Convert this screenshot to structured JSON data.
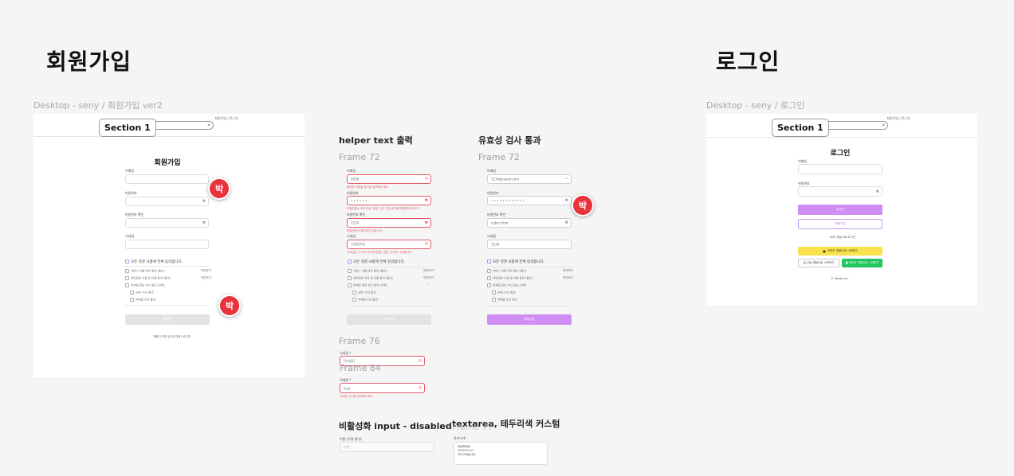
{
  "headings": {
    "signup": "회원가입",
    "login": "로그인"
  },
  "frames": {
    "signup_desktop": "Desktop - seny / 회원가입 ver2",
    "login_desktop": "Desktop - seny / 로그인",
    "helper_title": "helper text 출력",
    "helper_frame": "Frame 72",
    "valid_title": "유효성 검사 통과",
    "valid_frame": "Frame 72",
    "frame76": "Frame 76",
    "frame84": "Frame 84",
    "disabled_title": "비활성화 input - disabled",
    "textarea_title": "textarea, 테두리색 커스텀",
    "textarea_frame": "Frame 77"
  },
  "section_badge": "Section 1",
  "top_links": "회원가입 | 로그인",
  "avatar_letter": "박",
  "signup_form": {
    "title": "회원가입",
    "labels": [
      "이메일",
      "비밀번호",
      "비밀번호 확인",
      "닉네임"
    ],
    "agree_all": "모든 약관 사항에 전체 동의합니다.",
    "terms": [
      {
        "text": "서비스 이용 약관 동의 (필수)",
        "view": "약관보기"
      },
      {
        "text": "개인정보 수집 및 이용 동의 (필수)",
        "view": "약관보기"
      },
      {
        "text": "마케팅 정보 수신 동의 (선택)",
        "view": "⌄"
      }
    ],
    "sub_terms": [
      "SMS 수신 동의",
      "이메일 수신 동의"
    ],
    "submit": "회원가입",
    "footer": "계정이 이미 있으신가요? 로그인"
  },
  "helper_form": {
    "labels": [
      "이메일",
      "비밀번호",
      "비밀번호 확인",
      "닉네임"
    ],
    "values": [
      "2034",
      "• • • • • •",
      "1234",
      "닉네임가능"
    ],
    "errors": [
      "올바른 이메일 형식을 입력해주세요.",
      "비밀번호는 8자 이상, 영문, 숫자, 특수문자를 포함해야 합니다.",
      "비밀번호가 일치하지 않습니다.",
      "닉네임은 2-10자 이내의 한글, 영문, 숫자만 가능합니다."
    ],
    "agree_all": "모든 약관 사항에 전체 동의합니다.",
    "terms": [
      {
        "text": "서비스 이용 약관 동의 (필수)",
        "view": "약관보기"
      },
      {
        "text": "개인정보 수집 및 이용 동의 (필수)",
        "view": "약관보기"
      },
      {
        "text": "마케팅 정보 수신 동의 (선택)",
        "view": "⌄"
      }
    ],
    "sub_terms": [
      "SMS 수신 동의",
      "이메일 수신 동의"
    ],
    "submit": "회원가입"
  },
  "valid_form": {
    "labels": [
      "이메일",
      "비밀번호",
      "비밀번호 확인",
      "닉네임"
    ],
    "values": [
      "1234@naver.com",
      "• • • • • • • • • • • •",
      "cyber hum",
      "1234"
    ],
    "agree_all": "모든 약관 사항에 전체 동의합니다.",
    "terms": [
      {
        "text": "서비스 이용 약관 동의 (필수)",
        "view": "약관보기"
      },
      {
        "text": "개인정보 수집 및 이용 동의 (필수)",
        "view": "약관보기"
      },
      {
        "text": "마케팅 정보 수신 동의 (선택)",
        "view": "⌄"
      }
    ],
    "sub_terms": [
      "SMS 수신 동의",
      "이메일 수신 동의"
    ],
    "submit": "회원가입"
  },
  "frame76": {
    "label": "닉네임 *",
    "value": "[닉네임]",
    "error": ""
  },
  "frame84": {
    "label": "이메일 *",
    "value": "d:sk",
    "error": "이메일 주소를 입력해주세요."
  },
  "disabled_input": {
    "label": "이름 (수정 불가)",
    "value": "이름"
  },
  "textarea": {
    "label": "자기소개",
    "lines": [
      "안녕하세요",
      "2023.03.01",
      "자기소개입니다"
    ]
  },
  "login_form": {
    "title": "로그인",
    "labels": [
      "이메일",
      "비밀번호"
    ],
    "login_button": "로그인",
    "signup_button": "회원가입",
    "sns_text": "SNS 계정으로 로그인",
    "kakao": "카카오 계정으로 시작하기",
    "google": "구글 계정으로 시작하기",
    "naver": "네이버 계정으로 시작하기",
    "footer": "© Moodi_Inc."
  },
  "colors": {
    "accent_purple": "#d08ef5",
    "error_red": "#e05a6a",
    "kakao_yellow": "#f9e24b",
    "naver_green": "#20c55d",
    "avatar_red": "#e8323c"
  }
}
